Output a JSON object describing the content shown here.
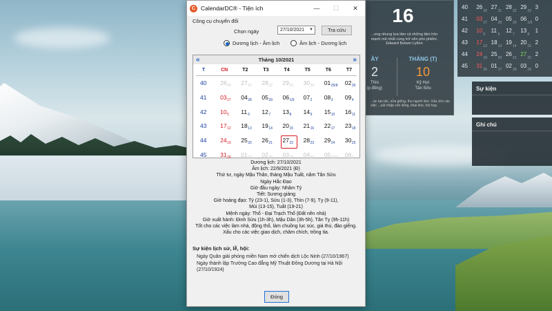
{
  "window": {
    "title": "CalendarDC® - Tiện ích",
    "minimize_glyph": "—",
    "maximize_glyph": "☐",
    "close_glyph": "✕"
  },
  "tool": {
    "label": "Công cụ chuyển đổi",
    "pick_label": "Chọn ngày",
    "date_value": "27/10/2021",
    "lookup_button": "Tra cứu",
    "radio_duong": "Dương lịch - Âm lịch",
    "radio_am": "Âm lịch - Dương lịch",
    "selected_radio": "duong"
  },
  "calendar": {
    "month_title": "Tháng 10/2021",
    "prev_glyph": "«",
    "next_glyph": "»",
    "dow": [
      "T",
      "CN",
      "T2",
      "T3",
      "T4",
      "T5",
      "T6",
      "T7"
    ],
    "rows": [
      {
        "week": "40",
        "days": [
          {
            "d": "26",
            "lu": "20",
            "other": true
          },
          {
            "d": "27",
            "lu": "21",
            "other": true
          },
          {
            "d": "28",
            "lu": "22",
            "other": true
          },
          {
            "d": "29",
            "lu": "23",
            "other": true
          },
          {
            "d": "30",
            "lu": "24",
            "other": true
          },
          {
            "d": "01",
            "lu": "25/8",
            "other": false
          },
          {
            "d": "02",
            "lu": "26",
            "other": false
          }
        ]
      },
      {
        "week": "41",
        "days": [
          {
            "d": "03",
            "lu": "27",
            "other": false
          },
          {
            "d": "04",
            "lu": "28",
            "other": false
          },
          {
            "d": "05",
            "lu": "29",
            "other": false
          },
          {
            "d": "06",
            "lu": "1/9",
            "other": false
          },
          {
            "d": "07",
            "lu": "2",
            "other": false
          },
          {
            "d": "08",
            "lu": "3",
            "other": false
          },
          {
            "d": "09",
            "lu": "4",
            "other": false
          }
        ]
      },
      {
        "week": "42",
        "days": [
          {
            "d": "10",
            "lu": "5",
            "other": false
          },
          {
            "d": "11",
            "lu": "6",
            "other": false
          },
          {
            "d": "12",
            "lu": "7",
            "other": false
          },
          {
            "d": "13",
            "lu": "8",
            "other": false
          },
          {
            "d": "14",
            "lu": "9",
            "other": false
          },
          {
            "d": "15",
            "lu": "10",
            "other": false
          },
          {
            "d": "16",
            "lu": "11",
            "other": false
          }
        ]
      },
      {
        "week": "43",
        "days": [
          {
            "d": "17",
            "lu": "12",
            "other": false
          },
          {
            "d": "18",
            "lu": "13",
            "other": false
          },
          {
            "d": "19",
            "lu": "14",
            "other": false
          },
          {
            "d": "20",
            "lu": "15",
            "other": false
          },
          {
            "d": "21",
            "lu": "16",
            "other": false
          },
          {
            "d": "22",
            "lu": "17",
            "other": false
          },
          {
            "d": "23",
            "lu": "18",
            "other": false
          }
        ]
      },
      {
        "week": "44",
        "days": [
          {
            "d": "24",
            "lu": "19",
            "other": false
          },
          {
            "d": "25",
            "lu": "20",
            "other": false
          },
          {
            "d": "26",
            "lu": "21",
            "other": false
          },
          {
            "d": "27",
            "lu": "22",
            "other": false,
            "selected": true
          },
          {
            "d": "28",
            "lu": "23",
            "other": false
          },
          {
            "d": "29",
            "lu": "24",
            "other": false
          },
          {
            "d": "30",
            "lu": "25",
            "other": false
          }
        ]
      },
      {
        "week": "45",
        "days": [
          {
            "d": "31",
            "lu": "26",
            "other": false
          },
          {
            "d": "01",
            "lu": "27",
            "other": true
          },
          {
            "d": "02",
            "lu": "28",
            "other": true
          },
          {
            "d": "03",
            "lu": "29",
            "other": true
          },
          {
            "d": "04",
            "lu": "30",
            "other": true
          },
          {
            "d": "05",
            "lu": "1/10",
            "other": true
          },
          {
            "d": "06",
            "lu": "2",
            "other": true
          }
        ]
      }
    ]
  },
  "info": {
    "lines": [
      "Dương lịch: 27/10/2021",
      "Âm lịch: 22/9/2021 (Đ)",
      "Thứ tư, ngày Mậu Thân, tháng Mậu Tuất, năm Tân Sửu",
      "Ngày Hắc Đạo",
      "Giờ đầu ngày: Nhâm Tý",
      "Tiết: Sương giáng",
      "Giờ hoàng đạo: Tý (23-1), Sửu (1-3), Thìn (7-9), Tỵ (9-11),",
      "Mùi (13-15), Tuất (19-21)",
      "Mệnh ngày: Thổ - Đại Trạch Thổ (Đất nền nhà)",
      "Giờ xuất hành: Đinh Sửu (1h-3h), Mậu Dần (3h-5h), Tân Tỵ (9h-11h)"
    ],
    "description": "Tốt cho các việc làm nhà, động thổ, làm chuồng lục súc, giá thú, đào giếng. Xấu cho các việc giao dịch, châm chích, trồng tỉa."
  },
  "history": {
    "title": "Sự kiện lịch sử, lễ, hội:",
    "items": [
      "Ngày Quân giải phóng miền Nam mở chiến dịch Lộc Ninh (27/10/1967)",
      "Ngày thành lập Trường Cao đẳng Mỹ Thuật Đông Dương tại Hà Nội (27/10/1924)"
    ]
  },
  "close_button": "Đóng",
  "widgets": {
    "today": {
      "day": "16",
      "quote": "...ong nhung lựa lâm cả những tâm hồn mạnh mẽ nhất cùng trở nên phù phiếm. Edward Bulwer Lytton",
      "left_head": "ÀY",
      "left_num": "2",
      "left_sub1": "Thìn",
      "left_sub2": "ịp đồng)",
      "right_head": "THÁNG (T)",
      "right_num": "10",
      "right_sub1": "Kỷ Hợi",
      "right_sub2": "Tân Sửu",
      "note": "...ác tạo tác, sửa giếng, thu người làm. Xấu cho các việc ...uất nhập vốn liếng, khai kho, hội họp."
    },
    "mini_month": [
      [
        {
          "d": "40",
          "c": ""
        },
        {
          "d": "26",
          "lu": "20",
          "c": ""
        },
        {
          "d": "27",
          "lu": "21",
          "c": ""
        },
        {
          "d": "28",
          "lu": "22",
          "c": ""
        },
        {
          "d": "29",
          "lu": "23",
          "c": ""
        },
        {
          "d": "3",
          "c": ""
        }
      ],
      [
        {
          "d": "41",
          "c": ""
        },
        {
          "d": "03",
          "lu": "27",
          "c": "red"
        },
        {
          "d": "04",
          "lu": "28",
          "c": ""
        },
        {
          "d": "05",
          "lu": "29",
          "c": ""
        },
        {
          "d": "06",
          "lu": "1/9",
          "c": ""
        },
        {
          "d": "0",
          "c": ""
        }
      ],
      [
        {
          "d": "42",
          "c": ""
        },
        {
          "d": "10",
          "lu": "5",
          "c": "red"
        },
        {
          "d": "11",
          "lu": "6",
          "c": ""
        },
        {
          "d": "12",
          "lu": "7",
          "c": ""
        },
        {
          "d": "13",
          "lu": "8",
          "c": ""
        },
        {
          "d": "1",
          "c": ""
        }
      ],
      [
        {
          "d": "43",
          "c": ""
        },
        {
          "d": "17",
          "lu": "12",
          "c": "red"
        },
        {
          "d": "18",
          "lu": "13",
          "c": ""
        },
        {
          "d": "19",
          "lu": "14",
          "c": ""
        },
        {
          "d": "20",
          "lu": "15",
          "c": ""
        },
        {
          "d": "2",
          "c": ""
        }
      ],
      [
        {
          "d": "44",
          "c": ""
        },
        {
          "d": "24",
          "lu": "19",
          "c": "red"
        },
        {
          "d": "25",
          "lu": "20",
          "c": ""
        },
        {
          "d": "26",
          "lu": "21",
          "c": ""
        },
        {
          "d": "27",
          "lu": "22",
          "c": "green"
        },
        {
          "d": "2",
          "c": ""
        }
      ],
      [
        {
          "d": "45",
          "c": ""
        },
        {
          "d": "31",
          "lu": "26",
          "c": "red"
        },
        {
          "d": "01",
          "lu": "27",
          "c": ""
        },
        {
          "d": "02",
          "lu": "28",
          "c": ""
        },
        {
          "d": "03",
          "lu": "29",
          "c": ""
        },
        {
          "d": "0",
          "c": ""
        }
      ]
    ],
    "events_title": "Sự kiện",
    "notes_title": "Ghi chú"
  },
  "colors": {
    "accent_blue": "#1a3fa0",
    "sunday_red": "#d71920",
    "selected_border": "#d71920"
  }
}
